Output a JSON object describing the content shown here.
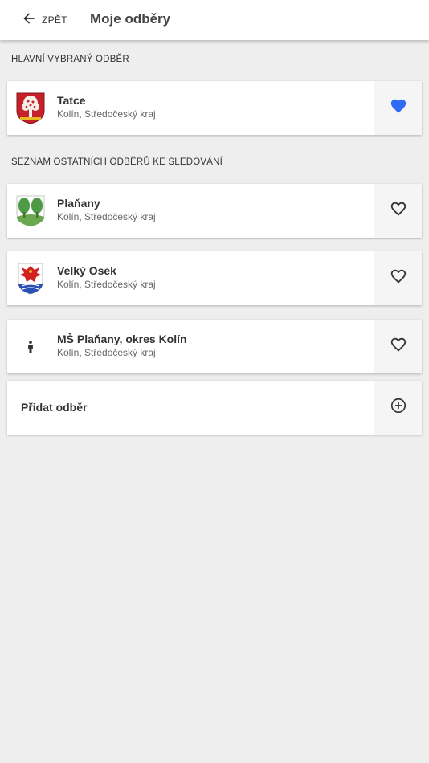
{
  "header": {
    "back_label": "ZPĚT",
    "title": "Moje odběry"
  },
  "main_section": {
    "heading": "HLAVNÍ VYBRANÝ ODBĚR",
    "item": {
      "name": "Tatce",
      "location": "Kolín, Středočeský kraj",
      "favorite": true,
      "icon": "tatce-coat-of-arms-icon"
    }
  },
  "other_section": {
    "heading": "SEZNAM OSTATNÍCH ODBĚRŮ KE SLEDOVÁNÍ",
    "items": [
      {
        "name": "Plaňany",
        "location": "Kolín, Středočeský kraj",
        "favorite": false,
        "icon": "planany-coat-of-arms-icon"
      },
      {
        "name": "Velký Osek",
        "location": "Kolín, Středočeský kraj",
        "favorite": false,
        "icon": "velky-osek-coat-of-arms-icon"
      },
      {
        "name": "MŠ Plaňany, okres Kolín",
        "location": "Kolín, Středočeský kraj",
        "favorite": false,
        "icon": "child-icon"
      }
    ]
  },
  "add_subscription": {
    "label": "Přidat odběr",
    "icon": "plus-circle-icon"
  },
  "colors": {
    "accent": "#2f6cf5",
    "background": "#eeeeee",
    "card": "#ffffff"
  }
}
